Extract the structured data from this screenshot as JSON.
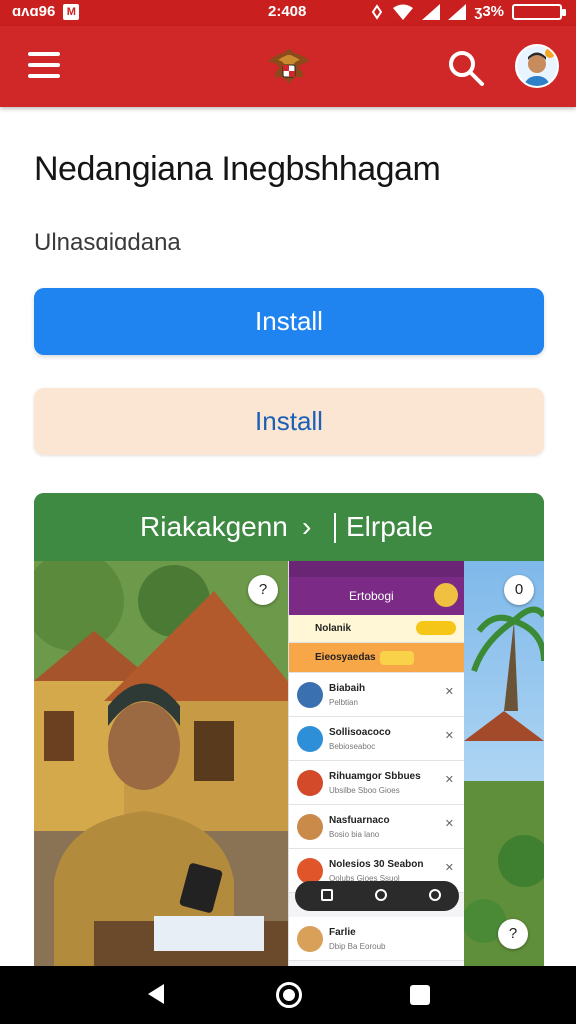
{
  "status_bar": {
    "carrier": "ɑʌɑ96",
    "time": "2:408",
    "battery": "ʒ3%"
  },
  "app_bar": {
    "menu_icon": "hamburger-icon",
    "logo_icon": "garuda-emblem-icon",
    "search_icon": "search-icon",
    "avatar_icon": "user-avatar-icon"
  },
  "main": {
    "title": "Nedangiana Inegbshhagam",
    "subtitle": "Ulnasɑiɑdana",
    "install_primary": "Install",
    "install_secondary": "Install"
  },
  "card": {
    "header_left": "Riakakgenn",
    "header_chevron": "›",
    "header_right": "Elrpale",
    "phone": {
      "title": "Ertobogi",
      "rows": [
        {
          "name": "Nolanik",
          "sub": ""
        },
        {
          "name": "Eieosyaedas",
          "sub": ""
        },
        {
          "name": "Biabaih",
          "sub": "Pelbtian"
        },
        {
          "name": "Sollisoacoco",
          "sub": "Bebioseaboc"
        },
        {
          "name": "Rihuamgor Sbbues",
          "sub": "Ubsilbe Sboo Gioes"
        },
        {
          "name": "Nasfuarnaco",
          "sub": "Bosio bia lano"
        },
        {
          "name": "Nolesios 30 Seabon",
          "sub": "Oolubs Gioes Ssuol"
        },
        {
          "name": "Farlie",
          "sub": "Dbip Ba Eoroub"
        }
      ]
    },
    "badge_top_left": "?",
    "badge_top_right": "0",
    "badge_bottom_right": "?"
  },
  "colors": {
    "status_bar": "#c91f1f",
    "app_bar": "#d02828",
    "primary_button": "#1f83f0",
    "secondary_button": "#fbe6d3",
    "card_header": "#3f8a43"
  }
}
